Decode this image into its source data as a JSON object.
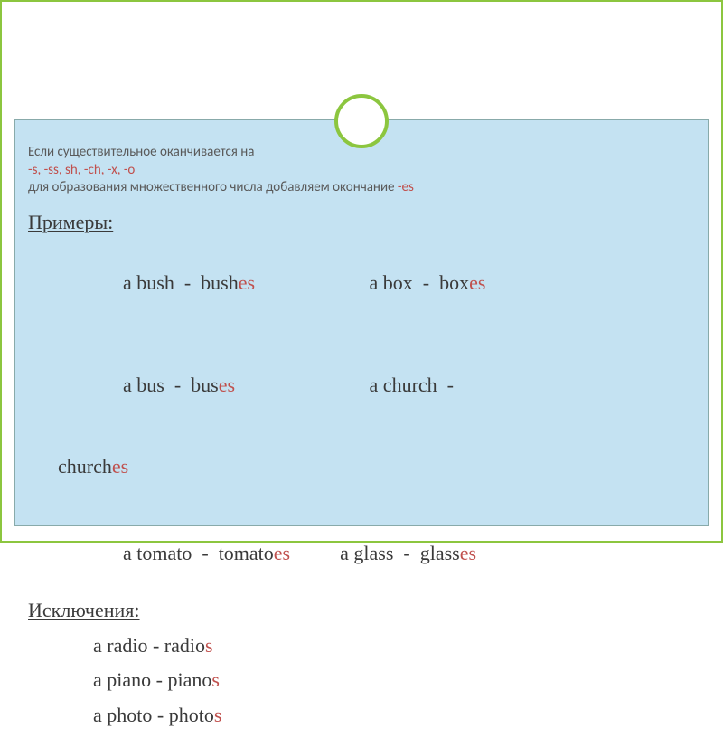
{
  "rule": {
    "line1": "Если существительное оканчивается на",
    "endings": "-s, -ss, sh, -ch, -x, -o",
    "line2a": "для образования множественного числа добавляем окончание  ",
    "line2_suffix": "-es"
  },
  "examplesHeader": "Примеры:",
  "examples": [
    {
      "a": "a bush  -  bush",
      "asuf": "es",
      "gap": "                       ",
      "b": "a box  -  box",
      "bsuf": "es"
    },
    {
      "a": "a bus  -  bus",
      "asuf": "es",
      "gap": "                           ",
      "b": "a church  -  ",
      "bsuf": "",
      "wrapPrefix": "church",
      "wrapSuf": "es"
    },
    {
      "a": "a tomato  -  tomato",
      "asuf": "es",
      "gap": "          ",
      "b": "a glass  -  glass",
      "bsuf": "es"
    }
  ],
  "exceptionsHeader": "Исключения:",
  "exceptions": [
    {
      "a": "a radio  -  radio",
      "asuf": "s"
    },
    {
      "a": "a piano  -  piano",
      "asuf": "s"
    },
    {
      "a": "a photo  -  photo",
      "asuf": "s"
    }
  ]
}
